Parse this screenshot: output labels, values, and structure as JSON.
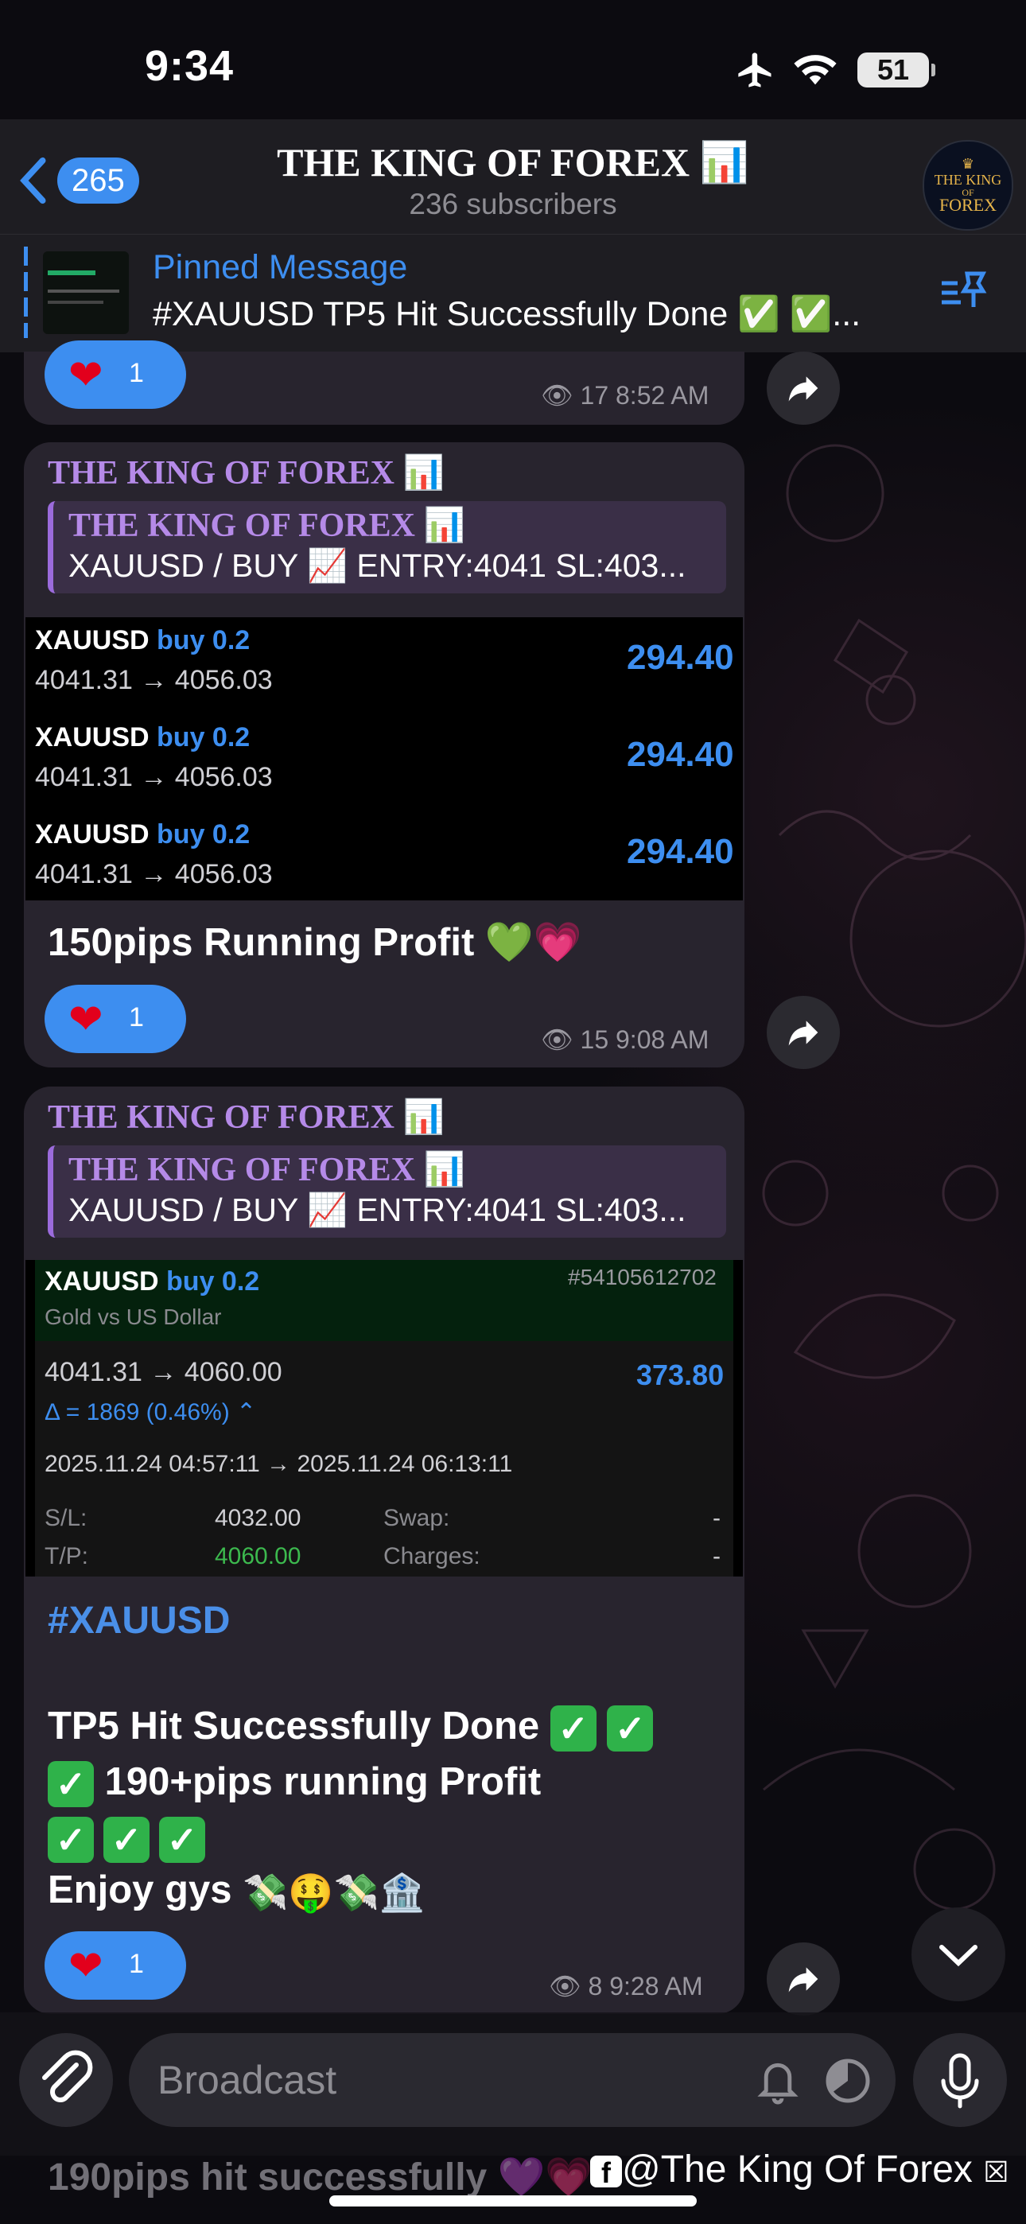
{
  "status_bar": {
    "time": "9:34",
    "battery": "51"
  },
  "header": {
    "back_count": "265",
    "title": "THE KING OF FOREX 📊",
    "subtitle": "236 subscribers",
    "avatar_line1": "THE KING",
    "avatar_line2": "OF",
    "avatar_line3": "FOREX"
  },
  "pinned": {
    "label": "Pinned Message",
    "text": "#XAUUSD TP5 Hit Successfully Done ✅ ✅..."
  },
  "msg0": {
    "reaction_count": "1",
    "views": "17",
    "time": "8:52 AM"
  },
  "msg1": {
    "forward_name": "THE KING OF FOREX 📊",
    "quote_name": "THE KING OF FOREX 📊",
    "quote_text": "XAUUSD / BUY 📈 ENTRY:4041 SL:403...",
    "trades": [
      {
        "symbol": "XAUUSD",
        "side": "buy 0.2",
        "prices": "4041.31 → 4056.03",
        "profit": "294.40"
      },
      {
        "symbol": "XAUUSD",
        "side": "buy 0.2",
        "prices": "4041.31 → 4056.03",
        "profit": "294.40"
      },
      {
        "symbol": "XAUUSD",
        "side": "buy 0.2",
        "prices": "4041.31 → 4056.03",
        "profit": "294.40"
      }
    ],
    "text": "150pips Running Profit 💚💗",
    "reaction_count": "1",
    "views": "15",
    "time": "9:08 AM"
  },
  "msg2": {
    "forward_name": "THE KING OF FOREX 📊",
    "quote_name": "THE KING OF FOREX 📊",
    "quote_text": "XAUUSD / BUY 📈 ENTRY:4041 SL:403...",
    "trade": {
      "symbol": "XAUUSD",
      "side": "buy 0.2",
      "ticket": "#54105612702",
      "desc": "Gold vs US Dollar",
      "prices": "4041.31 → 4060.00",
      "profit": "373.80",
      "delta": "Δ = 1869 (0.46%) ⌃",
      "times": "2025.11.24 04:57:11 → 2025.11.24 06:13:11",
      "sl_label": "S/L:",
      "sl_value": "4032.00",
      "swap_label": "Swap:",
      "swap_value": "-",
      "tp_label": "T/P:",
      "tp_value": "4060.00",
      "charges_label": "Charges:",
      "charges_value": "-"
    },
    "hashtag": "#XAUUSD",
    "line1": "TP5 Hit Successfully Done",
    "line2": "190+pips running Profit",
    "line4": "Enjoy gys",
    "line4_emoji": "💸🤑💸🏦",
    "reaction_count": "1",
    "views": "8",
    "time": "9:28 AM"
  },
  "peek_text": "190pips hit successfully 💜💗",
  "composer": {
    "placeholder": "Broadcast"
  },
  "watermark": "@The King Of Forex"
}
